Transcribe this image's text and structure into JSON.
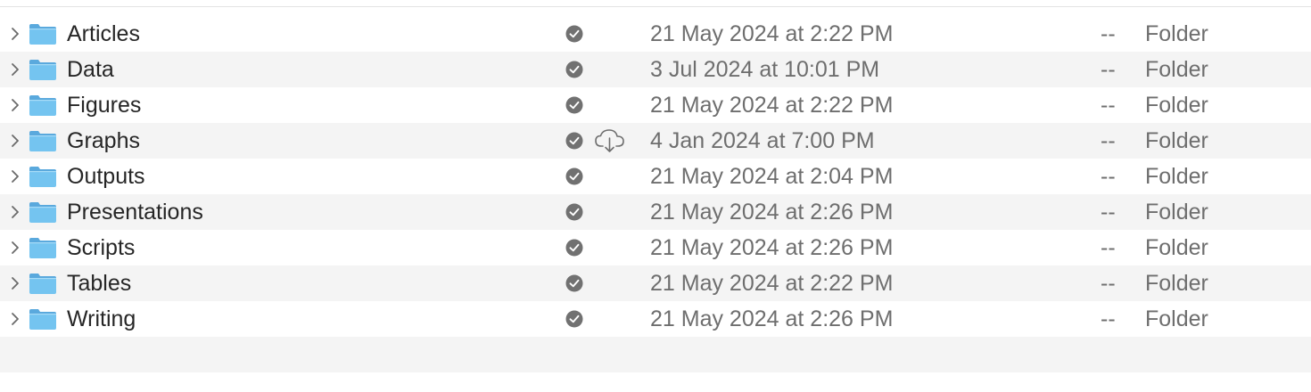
{
  "icons": {
    "disclosure": "chevron-right-icon",
    "folder": "folder-icon",
    "status": "synced-status-icon",
    "download": "cloud-download-icon"
  },
  "colors": {
    "folder_body": "#74c4f0",
    "folder_tab": "#5aa9dd",
    "status_badge": "#717171",
    "alt_row": "#f4f4f4"
  },
  "rows": [
    {
      "name": "Articles",
      "date": "21 May 2024 at 2:22 PM",
      "size": "--",
      "kind": "Folder"
    },
    {
      "name": "Data",
      "date": "3 Jul 2024 at 10:01 PM",
      "size": "--",
      "kind": "Folder"
    },
    {
      "name": "Figures",
      "date": "21 May 2024 at 2:22 PM",
      "size": "--",
      "kind": "Folder"
    },
    {
      "name": "Graphs",
      "date": "4 Jan 2024 at 7:00 PM",
      "size": "--",
      "kind": "Folder",
      "cloud": true
    },
    {
      "name": "Outputs",
      "date": "21 May 2024 at 2:04 PM",
      "size": "--",
      "kind": "Folder"
    },
    {
      "name": "Presentations",
      "date": "21 May 2024 at 2:26 PM",
      "size": "--",
      "kind": "Folder"
    },
    {
      "name": "Scripts",
      "date": "21 May 2024 at 2:26 PM",
      "size": "--",
      "kind": "Folder"
    },
    {
      "name": "Tables",
      "date": "21 May 2024 at 2:22 PM",
      "size": "--",
      "kind": "Folder"
    },
    {
      "name": "Writing",
      "date": "21 May 2024 at 2:26 PM",
      "size": "--",
      "kind": "Folder"
    }
  ]
}
